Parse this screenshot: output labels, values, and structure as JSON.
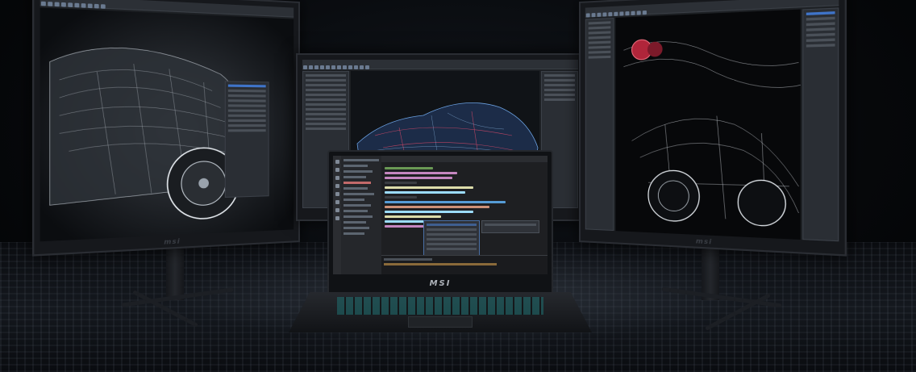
{
  "brand": {
    "logo_text": "MSI"
  },
  "scene": {
    "left_monitor": {
      "logo": "msi"
    },
    "center_monitor": {
      "logo": "msi"
    },
    "right_monitor": {
      "logo": "msi"
    },
    "laptop": {
      "logo": "msi"
    }
  },
  "colors": {
    "background": "#050608",
    "keyboard_backlight": "#1f6f70",
    "ide_accent": "#4a6fa5"
  }
}
